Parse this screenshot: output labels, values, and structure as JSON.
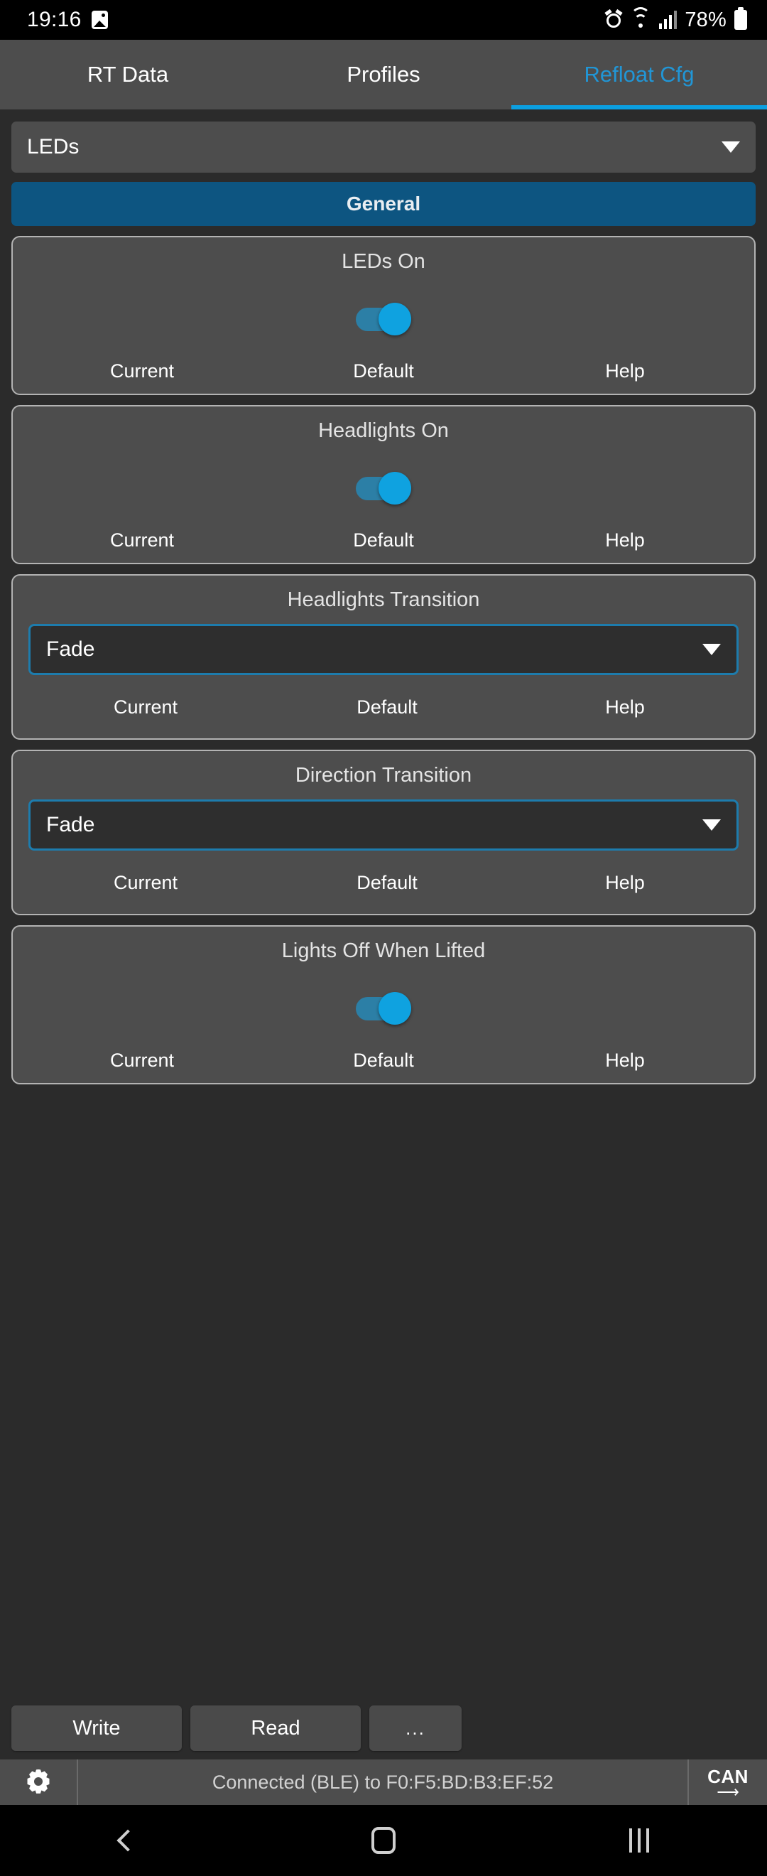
{
  "status_bar": {
    "time": "19:16",
    "battery_percent": "78%",
    "icons": [
      "image-icon",
      "alarm-icon",
      "wifi-icon",
      "signal-icon",
      "battery-icon"
    ]
  },
  "tabs": [
    {
      "label": "RT Data",
      "active": false
    },
    {
      "label": "Profiles",
      "active": false
    },
    {
      "label": "Refloat Cfg",
      "active": true
    }
  ],
  "page_selector": {
    "value": "LEDs"
  },
  "section_header": {
    "label": "General"
  },
  "action_labels": {
    "current": "Current",
    "default": "Default",
    "help": "Help"
  },
  "cards": [
    {
      "title": "LEDs On",
      "type": "toggle",
      "value": "on"
    },
    {
      "title": "Headlights On",
      "type": "toggle",
      "value": "on"
    },
    {
      "title": "Headlights Transition",
      "type": "select",
      "value": "Fade"
    },
    {
      "title": "Direction Transition",
      "type": "select",
      "value": "Fade"
    },
    {
      "title": "Lights Off When Lifted",
      "type": "toggle",
      "value": "on"
    }
  ],
  "buttons": {
    "write": "Write",
    "read": "Read",
    "more": "..."
  },
  "connection": {
    "status_text": "Connected (BLE) to F0:F5:BD:B3:EF:52",
    "can_label": "CAN",
    "can_arrow": "⟶"
  },
  "colors": {
    "accent_blue": "#0c9fe0",
    "tab_active": "#2196d6",
    "section_header_bg": "#0d5581",
    "select_border": "#1d7cad",
    "toggle_track": "#2c7fa6",
    "toggle_thumb": "#0fa2e0",
    "page_bg": "#2b2b2b",
    "card_bg": "#4d4d4d",
    "card_border": "#b3b3b3"
  }
}
